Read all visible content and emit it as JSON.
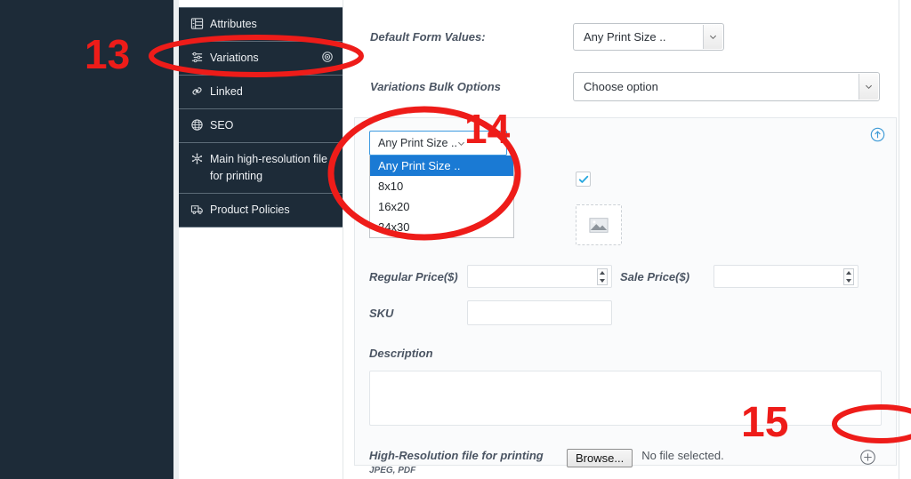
{
  "sidebar": {
    "items": [
      {
        "label": "Attributes",
        "icon": "attributes-list-icon",
        "right_icon": null
      },
      {
        "label": "Variations",
        "icon": "variations-sliders-icon",
        "right_icon": "gear-target-icon"
      },
      {
        "label": "Linked",
        "icon": "link-icon",
        "right_icon": null
      },
      {
        "label": "SEO",
        "icon": "globe-icon",
        "right_icon": null
      },
      {
        "label": "Main high-resolution file for printing",
        "icon": "snowflake-icon",
        "right_icon": null
      },
      {
        "label": "Product Policies",
        "icon": "truck-icon",
        "right_icon": null
      }
    ]
  },
  "form": {
    "default_form_values_label": "Default Form Values:",
    "default_form_values_selected": "Any Print Size ..",
    "bulk_options_label": "Variations Bulk Options",
    "bulk_options_selected": "Choose option"
  },
  "variation_card": {
    "size_select_value": "Any Print Size ..",
    "size_options": [
      "Any Print Size ..",
      "8x10",
      "16x20",
      "24x30"
    ],
    "highlighted_option": "Any Print Size ..",
    "collapse_icon": "circle-arrow-up-icon",
    "enabled_checkbox": "checkbox-checked-icon",
    "image_placeholder": "image-placeholder-icon",
    "regular_price_label": "Regular Price($)",
    "regular_price_value": "",
    "sale_price_label": "Sale Price($)",
    "sale_price_value": "",
    "sku_label": "SKU",
    "sku_value": "",
    "description_label": "Description",
    "description_value": "",
    "highres_label": "High-Resolution file for printing",
    "highres_formats": "JPEG, PDF",
    "browse_button": "Browse...",
    "file_status": "No file selected.",
    "add_icon": "circle-plus-icon"
  },
  "annotations": {
    "markers": [
      {
        "id": "13",
        "text": "13",
        "target": "sidebar-item-variations"
      },
      {
        "id": "14",
        "text": "14",
        "target": "variation-size-select"
      },
      {
        "id": "15",
        "text": "15",
        "target": "add-variation-button"
      }
    ],
    "color": "#ee1c19"
  },
  "colors": {
    "sidebar_dark": "#1d2b38",
    "annotation_red": "#ee1c19",
    "option_highlight": "#1a7ad4",
    "checkbox_check": "#29a8df",
    "focus_border": "#3d9ae0"
  }
}
